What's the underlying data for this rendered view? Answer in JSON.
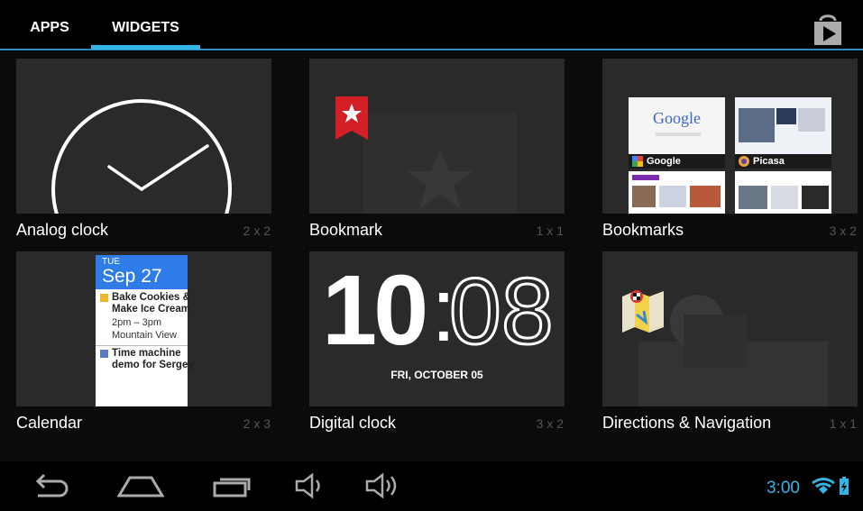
{
  "tabs": {
    "apps_label": "APPS",
    "widgets_label": "WIDGETS",
    "active": "WIDGETS"
  },
  "store_icon": "play-store-icon",
  "widgets": [
    {
      "name": "Analog clock",
      "size": "2 x 2"
    },
    {
      "name": "Bookmark",
      "size": "1 x 1"
    },
    {
      "name": "Bookmarks",
      "size": "3 x 2"
    },
    {
      "name": "Calendar",
      "size": "2 x 3"
    },
    {
      "name": "Digital clock",
      "size": "3 x 2"
    },
    {
      "name": "Directions & Navigation",
      "size": "1 x 1"
    }
  ],
  "bookmarks_preview": {
    "google_caption": "Google",
    "picasa_caption": "Picasa",
    "google_logo": "Google"
  },
  "calendar_preview": {
    "day": "TUE",
    "date": "Sep 27",
    "event1_title_1": "Bake Cookies &",
    "event1_title_2": "Make Ice Cream",
    "event1_time": "2pm – 3pm",
    "event1_location": "Mountain View",
    "event2_title_1": "Time machine",
    "event2_title_2": "demo for Sergey"
  },
  "digital_clock_preview": {
    "hour": "10",
    "minute": "08",
    "date": "FRI, OCTOBER 05"
  },
  "navbar": {
    "icons": [
      "back-icon",
      "home-icon",
      "recents-icon",
      "volume-down-icon",
      "volume-up-icon"
    ]
  },
  "status": {
    "time": "3:00",
    "icons": [
      "wifi-icon",
      "battery-charging-icon"
    ]
  },
  "colors": {
    "accent": "#33b5e5",
    "tile_background": "#2a2a2a",
    "size_text": "#555555"
  }
}
